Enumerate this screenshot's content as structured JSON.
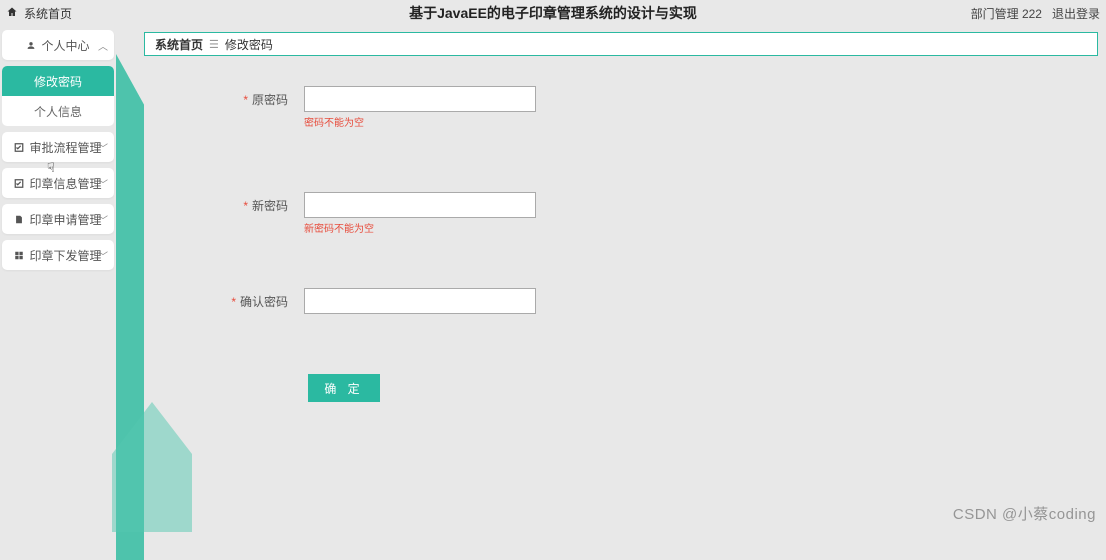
{
  "header": {
    "home_label": "系统首页",
    "title": "基于JavaEE的电子印章管理系统的设计与实现",
    "user_label": "部门管理 222",
    "logout_label": "退出登录"
  },
  "sidebar": {
    "personal_center": "个人中心",
    "sub_items": [
      {
        "label": "修改密码",
        "active": true
      },
      {
        "label": "个人信息",
        "active": false
      }
    ],
    "items": [
      {
        "label": "审批流程管理"
      },
      {
        "label": "印章信息管理"
      },
      {
        "label": "印章申请管理"
      },
      {
        "label": "印章下发管理"
      }
    ]
  },
  "breadcrumb": {
    "root": "系统首页",
    "current": "修改密码"
  },
  "form": {
    "old_pw_label": "原密码",
    "old_pw_error": "密码不能为空",
    "new_pw_label": "新密码",
    "new_pw_error": "新密码不能为空",
    "confirm_pw_label": "确认密码",
    "submit_label": "确 定",
    "old_pw_value": "",
    "new_pw_value": "",
    "confirm_pw_value": ""
  },
  "watermark": "CSDN @小蔡coding"
}
